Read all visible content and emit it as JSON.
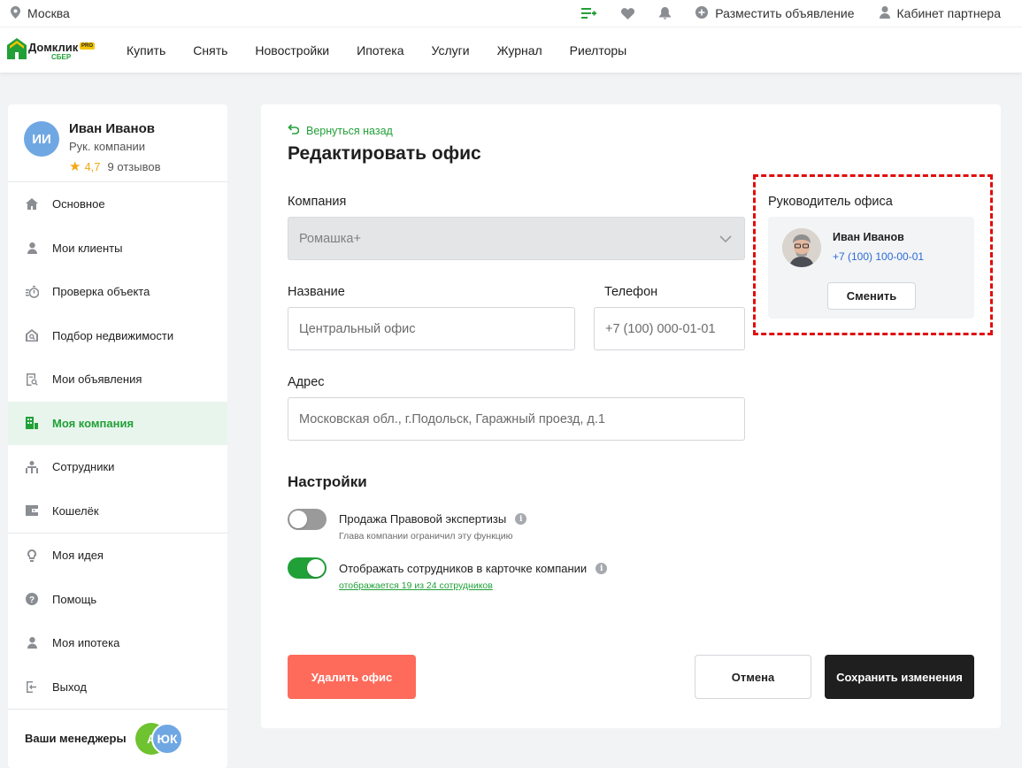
{
  "topbar": {
    "city": "Москва",
    "post_ad": "Разместить объявление",
    "partner_cabinet": "Кабинет партнера",
    "icons": [
      "location-pin-icon",
      "compare-list-icon",
      "heart-icon",
      "bell-icon",
      "plus-circle-icon",
      "user-icon"
    ]
  },
  "logo": {
    "brand": "Домклик",
    "pro": "PRO",
    "sber": "СБЕР"
  },
  "nav": {
    "items": [
      "Купить",
      "Снять",
      "Новостройки",
      "Ипотека",
      "Услуги",
      "Журнал",
      "Риелторы"
    ]
  },
  "profile": {
    "initials": "ИИ",
    "name": "Иван Иванов",
    "role": "Рук. компании",
    "rating": "4,7",
    "reviews": "9 отзывов"
  },
  "sidebar": {
    "items": [
      {
        "label": "Основное",
        "icon": "home-icon"
      },
      {
        "label": "Мои клиенты",
        "icon": "person-icon"
      },
      {
        "label": "Проверка объекта",
        "icon": "stopwatch-icon"
      },
      {
        "label": "Подбор недвижимости",
        "icon": "house-search-icon"
      },
      {
        "label": "Мои объявления",
        "icon": "document-search-icon"
      },
      {
        "label": "Моя компания",
        "icon": "building-icon",
        "active": true
      },
      {
        "label": "Сотрудники",
        "icon": "staff-icon"
      },
      {
        "label": "Кошелёк",
        "icon": "wallet-icon"
      }
    ],
    "items2": [
      {
        "label": "Моя идея",
        "icon": "lightbulb-icon"
      },
      {
        "label": "Помощь",
        "icon": "help-icon"
      },
      {
        "label": "Моя ипотека",
        "icon": "person-icon"
      },
      {
        "label": "Выход",
        "icon": "logout-icon"
      }
    ],
    "managers_label": "Ваши менеджеры",
    "manager_a": "А",
    "manager_b": "ЮК"
  },
  "form": {
    "back": "Вернуться назад",
    "title": "Редактировать офис",
    "company_label": "Компания",
    "company_value": "Ромашка+",
    "name_label": "Название",
    "name_value": "Центральный офис",
    "phone_label": "Телефон",
    "phone_value": "+7 (100) 000-01-01",
    "address_label": "Адрес",
    "address_value": "Московская обл., г.Подольск, Гаражный проезд, д.1",
    "settings_title": "Настройки",
    "setting1_title": "Продажа Правовой экспертизы",
    "setting1_sub": "Глава компании ограничил эту функцию",
    "setting1_on": false,
    "setting2_title": "Отображать сотрудников в карточке компании",
    "setting2_link": "отображается 19 из 24  сотрудников",
    "setting2_on": true
  },
  "head": {
    "label": "Руководитель офиса",
    "name": "Иван Иванов",
    "phone": "+7 (100) 100-00-01",
    "change": "Сменить"
  },
  "buttons": {
    "delete": "Удалить офис",
    "cancel": "Отмена",
    "save": "Сохранить изменения"
  },
  "colors": {
    "accent": "#21a038",
    "delete": "#fe6b5b",
    "save": "#1f1f1f",
    "link": "#2a6ad6",
    "highlight": "#e00d0d"
  }
}
